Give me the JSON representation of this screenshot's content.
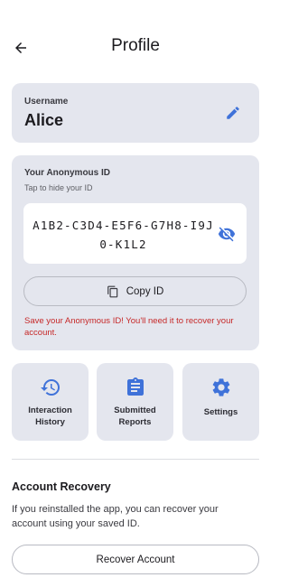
{
  "header": {
    "title": "Profile",
    "back_icon": "arrow-back-icon"
  },
  "username": {
    "label": "Username",
    "value": "Alice",
    "edit_icon": "pencil-icon"
  },
  "anonymous_id": {
    "title": "Your Anonymous ID",
    "hint": "Tap to hide your ID",
    "value": "A1B2-C3D4-E5F6-G7H8-I9J0-K1L2",
    "visibility_icon": "eye-off-icon",
    "copy_label": "Copy ID",
    "copy_icon": "copy-icon",
    "warning": "Save your Anonymous ID! You'll need it to recover your account."
  },
  "tiles": [
    {
      "label": "Interaction History",
      "icon": "history-icon"
    },
    {
      "label": "Submitted Reports",
      "icon": "clipboard-icon"
    },
    {
      "label": "Settings",
      "icon": "gear-icon"
    }
  ],
  "recovery": {
    "title": "Account Recovery",
    "description": "If you reinstalled the app, you can recover your account using your saved ID.",
    "button_label": "Recover Account"
  },
  "colors": {
    "accent": "#3f72d9",
    "card_bg": "#e4e6ee",
    "warning": "#c62828"
  }
}
